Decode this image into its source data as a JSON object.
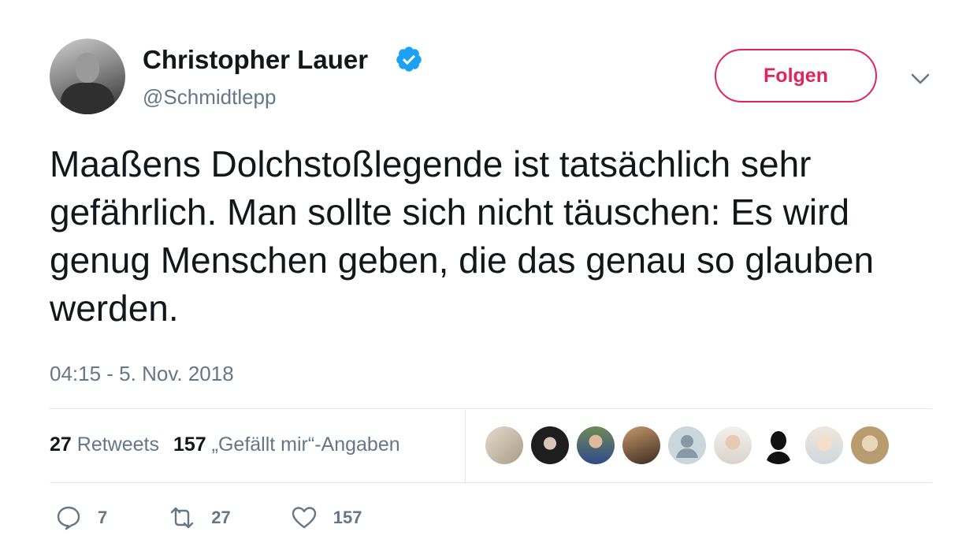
{
  "author": {
    "name": "Christopher Lauer",
    "handle": "@Schmidtlepp",
    "verified_icon": "verified-badge-icon",
    "verified_color": "#1da1f2"
  },
  "follow_button": {
    "label": "Folgen",
    "color": "#e0245e"
  },
  "menu_icon": "chevron-down-icon",
  "tweet": {
    "text": "Maaßens Dolchstoßlegende ist tatsächlich sehr gefährlich. Man sollte sich nicht täuschen: Es wird genug Menschen geben, die das genau so glauben werden.",
    "timestamp": "04:15 - 5. Nov. 2018"
  },
  "stats": {
    "retweets_count": "27",
    "retweets_label": "Retweets",
    "likes_count": "157",
    "likes_label": "„Gefällt mir“-Angaben"
  },
  "likers": [
    {
      "name": "liker-avatar-1",
      "color": "#c9b9a3"
    },
    {
      "name": "liker-avatar-2",
      "color": "#2a2a2a"
    },
    {
      "name": "liker-avatar-3",
      "color": "#4b6a3c"
    },
    {
      "name": "liker-avatar-4",
      "color": "#7a5a3a"
    },
    {
      "name": "liker-avatar-5",
      "color": "#ccd6dd"
    },
    {
      "name": "liker-avatar-6",
      "color": "#e8e2dc"
    },
    {
      "name": "liker-avatar-7",
      "color": "#ffffff"
    },
    {
      "name": "liker-avatar-8",
      "color": "#f2e6d6"
    },
    {
      "name": "liker-avatar-9",
      "color": "#d8c7a8"
    }
  ],
  "actions": {
    "reply_count": "7",
    "retweet_count": "27",
    "like_count": "157",
    "icons": [
      "reply-icon",
      "retweet-icon",
      "heart-icon"
    ],
    "icon_color": "#657786"
  }
}
